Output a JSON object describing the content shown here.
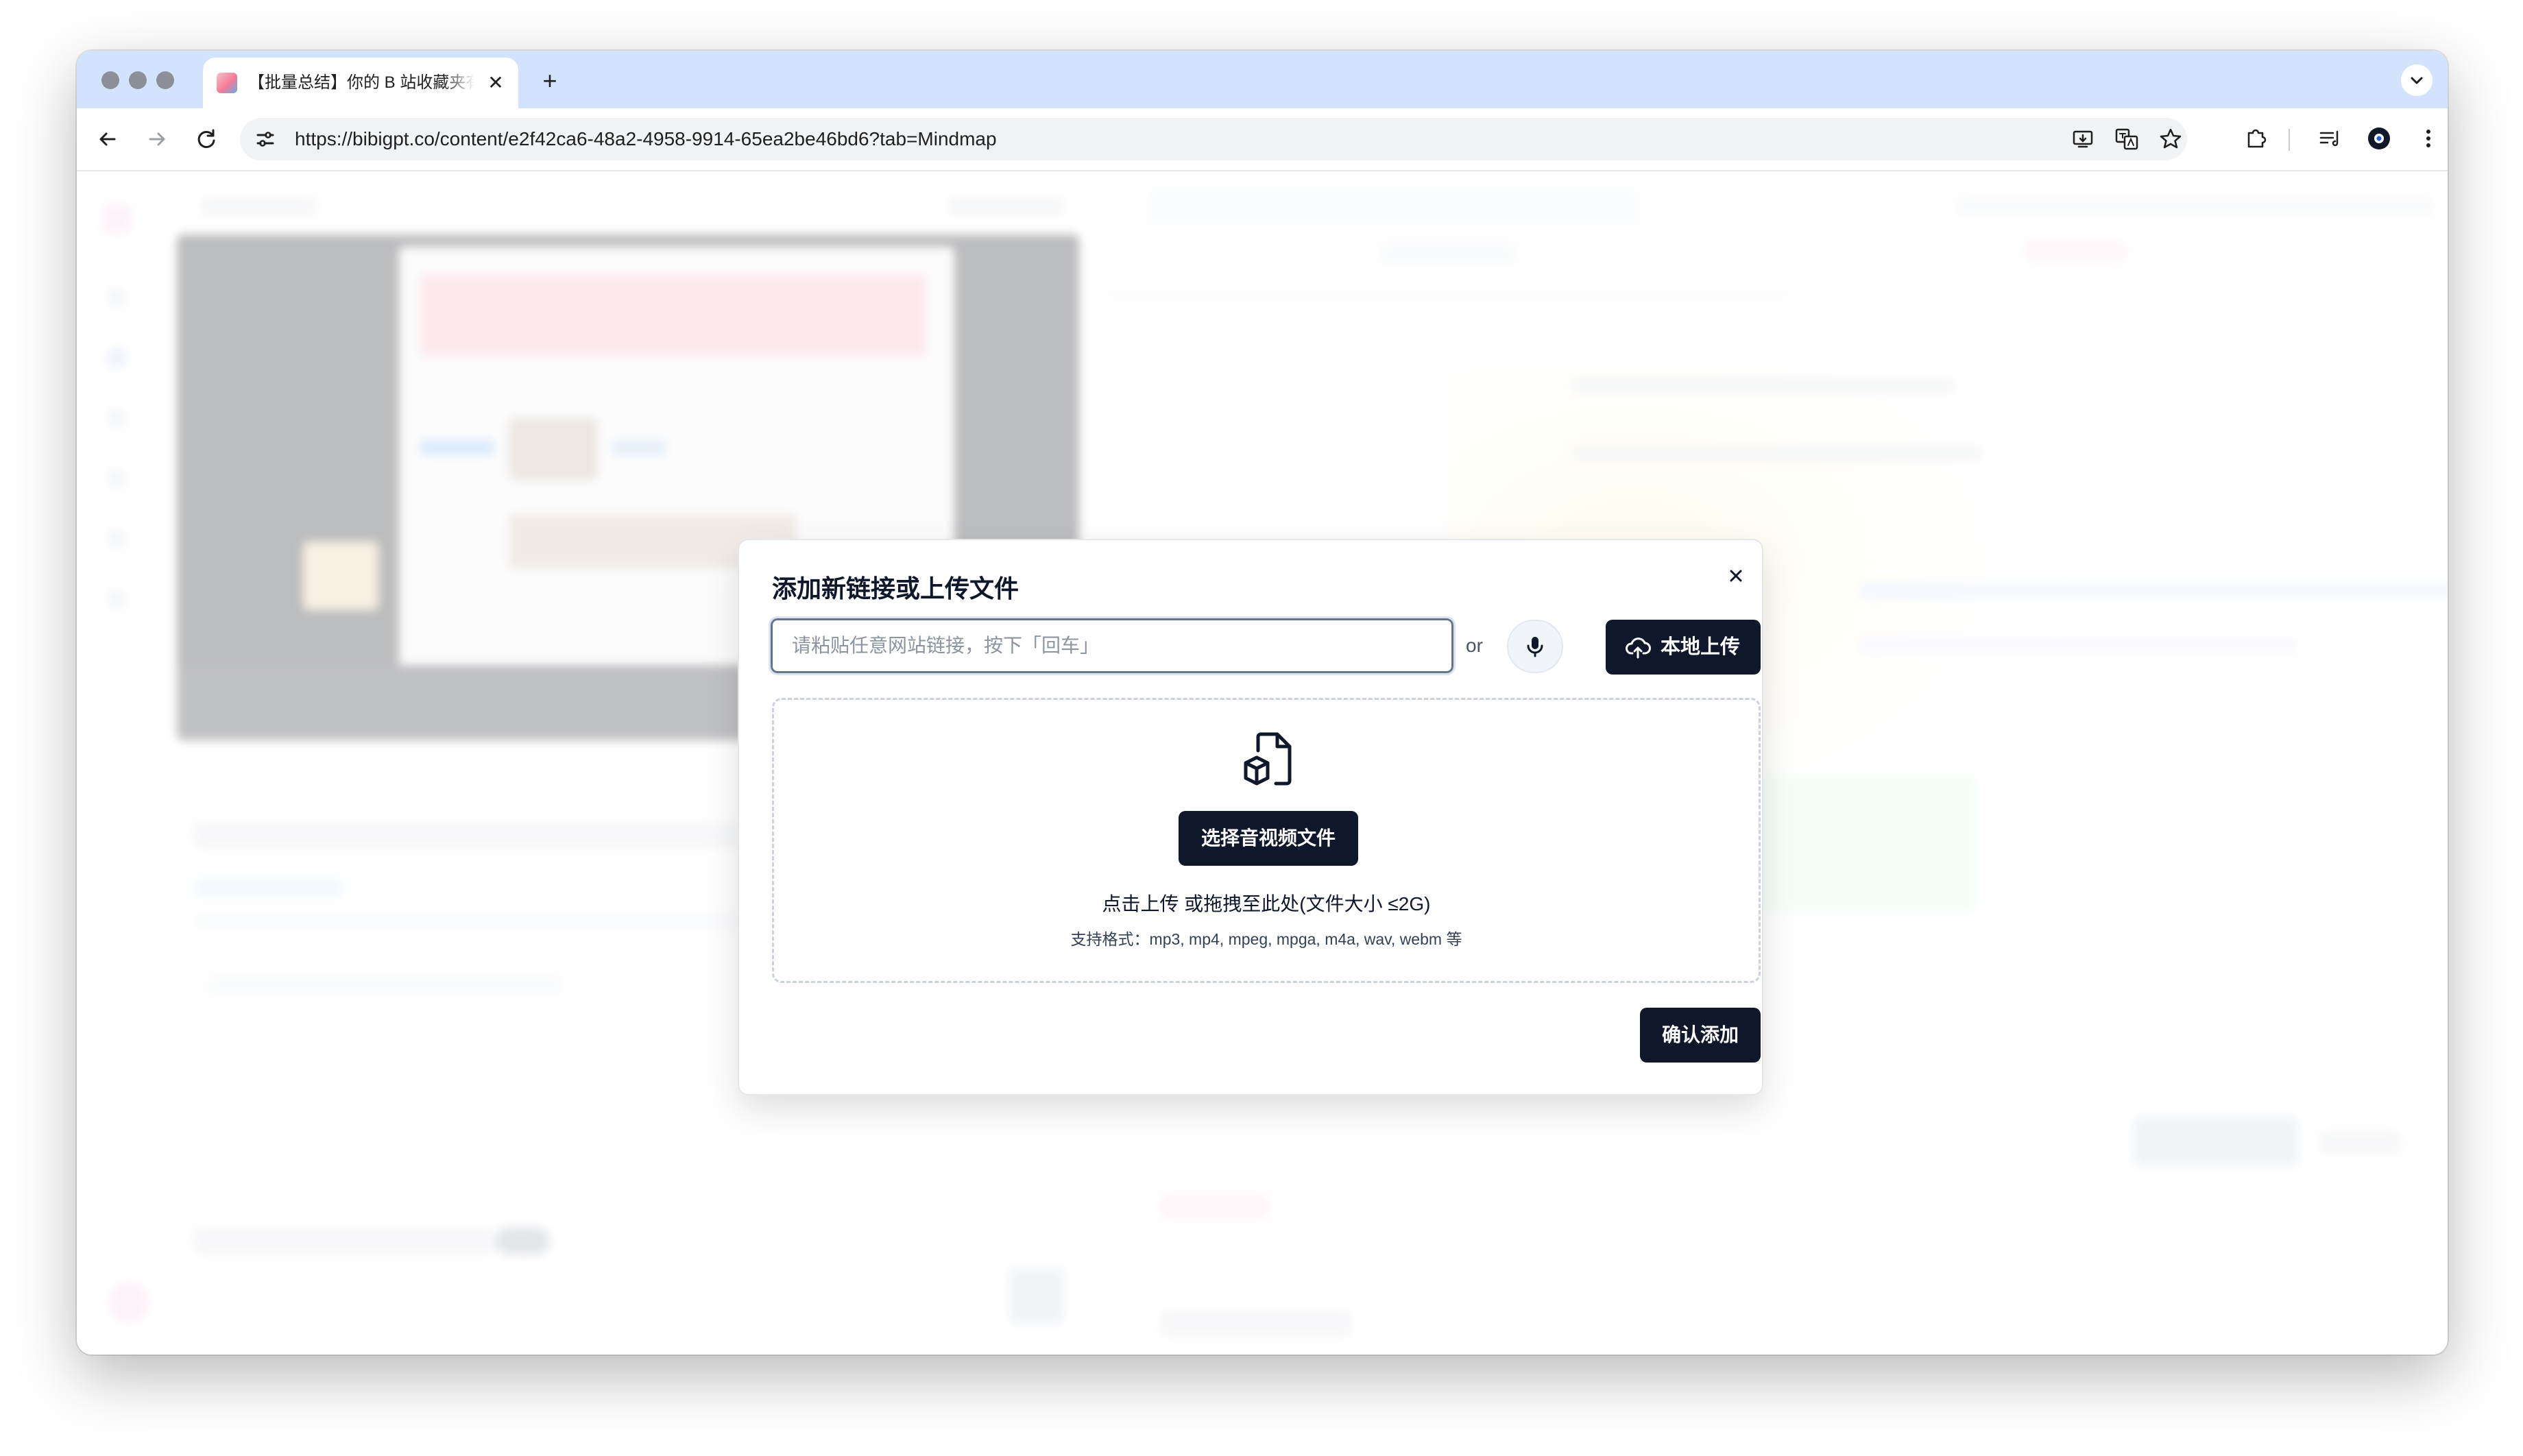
{
  "browser": {
    "tab": {
      "title": "【批量总结】你的 B 站收藏夹有"
    },
    "address_bar": {
      "url": "https://bibigpt.co/content/e2f42ca6-48a2-4958-9914-65ea2be46bd6?tab=Mindmap"
    },
    "icons": [
      "back-icon",
      "forward-icon",
      "reload-icon",
      "site-info-icon",
      "install-app-icon",
      "translate-icon",
      "bookmark-star-icon",
      "extensions-icon",
      "reading-list-icon",
      "profile-icon",
      "kebab-menu-icon"
    ]
  },
  "modal": {
    "title": "添加新链接或上传文件",
    "link_input": {
      "value": "",
      "placeholder": "请粘贴任意网站链接，按下「回车」"
    },
    "or_label": "or",
    "upload_button": "本地上传",
    "dropzone": {
      "choose_button": "选择音视频文件",
      "hint": "点击上传 或拖拽至此处(文件大小 ≤2G)",
      "formats": "支持格式：mp3, mp4, mpeg, mpga, m4a, wav, webm 等"
    },
    "confirm_button": "确认添加"
  },
  "colors": {
    "primary": "#0f172a",
    "tabstrip": "#d3e3fd",
    "overlay": "rgba(255,255,255,0.72)"
  }
}
